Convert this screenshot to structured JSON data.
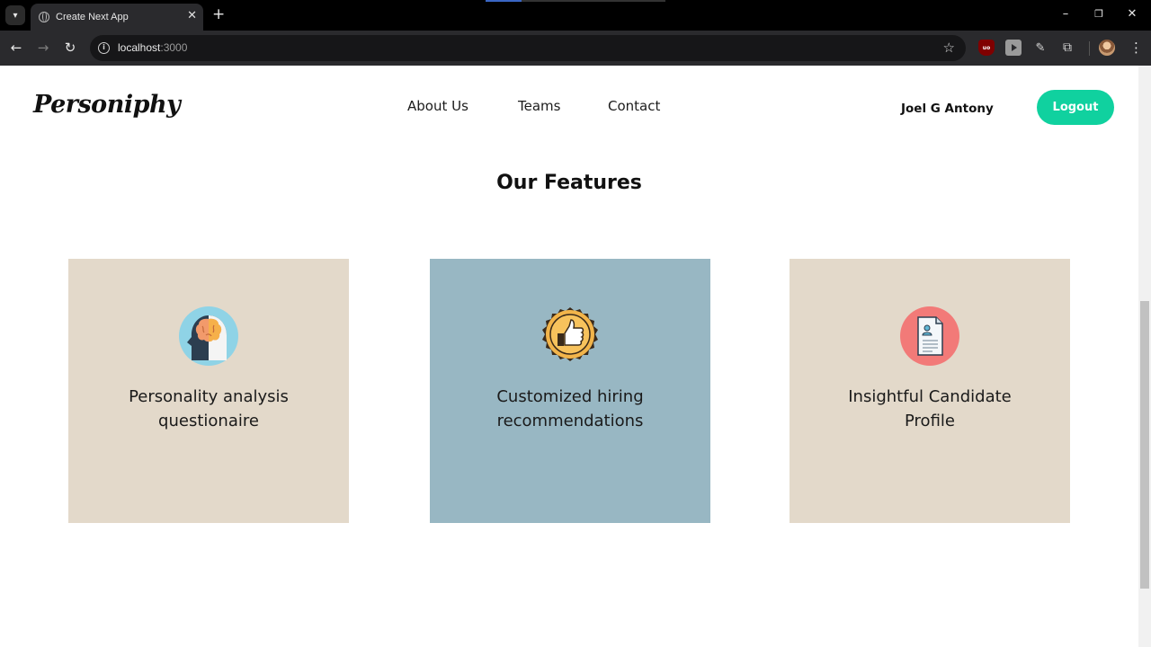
{
  "browser": {
    "tab_title": "Create Next App",
    "url_host": "localhost",
    "url_port": ":3000"
  },
  "header": {
    "logo": "Personiphy",
    "nav": [
      "About Us",
      "Teams",
      "Contact"
    ],
    "user_name": "Joel G Antony",
    "logout_label": "Logout"
  },
  "features": {
    "title": "Our Features",
    "cards": [
      {
        "line1": "Personality analysis",
        "line2": "questionaire",
        "background": "#e3d9ca",
        "icon": "brain-head-icon"
      },
      {
        "line1": "Customized hiring",
        "line2": "recommendations",
        "background": "#98b7c3",
        "icon": "thumbs-up-badge-icon"
      },
      {
        "line1": "Insightful Candidate",
        "line2": "Profile",
        "background": "#e3d9ca",
        "icon": "profile-document-icon"
      }
    ]
  },
  "colors": {
    "accent": "#10d19f"
  }
}
